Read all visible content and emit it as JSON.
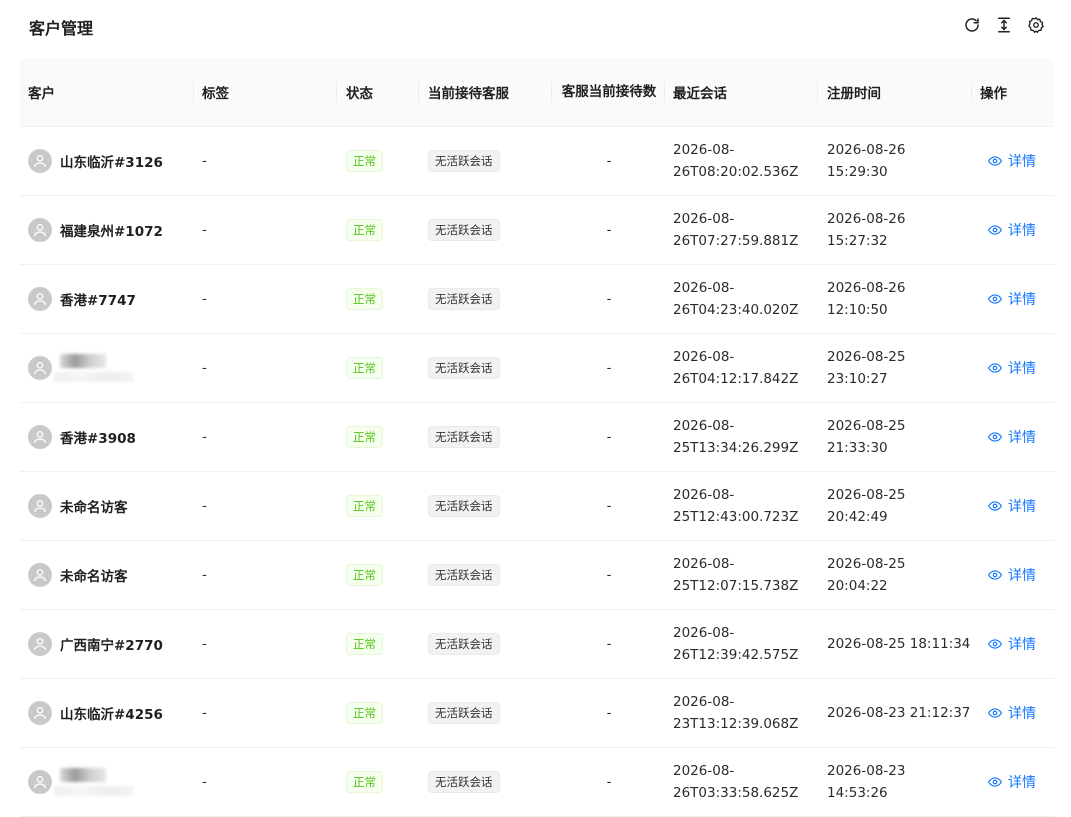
{
  "page": {
    "title": "客户管理"
  },
  "toolbar": {
    "icons": [
      "refresh-icon",
      "column-height-icon",
      "settings-icon"
    ]
  },
  "table": {
    "columns": {
      "customer": "客户",
      "tags": "标签",
      "status": "状态",
      "current_agent": "当前接待客服",
      "agent_count": "客服当前接待数",
      "last_session": "最近会话",
      "register_time": "注册时间",
      "actions": "操作"
    },
    "rows": [
      {
        "name": "山东临沂#3126",
        "tags": "-",
        "status": "正常",
        "agent": "无活跃会话",
        "agent_count": "-",
        "last_session": "2026-08-\n26T08:20:02.536Z",
        "register_time": "2026-08-26\n15:29:30",
        "action": "详情"
      },
      {
        "name": "福建泉州#1072",
        "tags": "-",
        "status": "正常",
        "agent": "无活跃会话",
        "agent_count": "-",
        "last_session": "2026-08-\n26T07:27:59.881Z",
        "register_time": "2026-08-26\n15:27:32",
        "action": "详情"
      },
      {
        "name": "香港#7747",
        "tags": "-",
        "status": "正常",
        "agent": "无活跃会话",
        "agent_count": "-",
        "last_session": "2026-08-\n26T04:23:40.020Z",
        "register_time": "2026-08-26\n12:10:50",
        "action": "详情"
      },
      {
        "name": "",
        "tags": "-",
        "status": "正常",
        "agent": "无活跃会话",
        "agent_count": "-",
        "last_session": "2026-08-\n26T04:12:17.842Z",
        "register_time": "2026-08-25\n23:10:27",
        "action": "详情"
      },
      {
        "name": "香港#3908",
        "tags": "-",
        "status": "正常",
        "agent": "无活跃会话",
        "agent_count": "-",
        "last_session": "2026-08-\n25T13:34:26.299Z",
        "register_time": "2026-08-25\n21:33:30",
        "action": "详情"
      },
      {
        "name": "未命名访客",
        "tags": "-",
        "status": "正常",
        "agent": "无活跃会话",
        "agent_count": "-",
        "last_session": "2026-08-\n25T12:43:00.723Z",
        "register_time": "2026-08-25\n20:42:49",
        "action": "详情"
      },
      {
        "name": "未命名访客",
        "tags": "-",
        "status": "正常",
        "agent": "无活跃会话",
        "agent_count": "-",
        "last_session": "2026-08-\n25T12:07:15.738Z",
        "register_time": "2026-08-25\n20:04:22",
        "action": "详情"
      },
      {
        "name": "广西南宁#2770",
        "tags": "-",
        "status": "正常",
        "agent": "无活跃会话",
        "agent_count": "-",
        "last_session": "2026-08-\n26T12:39:42.575Z",
        "register_time": "2026-08-25 18:11:34",
        "action": "详情"
      },
      {
        "name": "山东临沂#4256",
        "tags": "-",
        "status": "正常",
        "agent": "无活跃会话",
        "agent_count": "-",
        "last_session": "2026-08-\n23T13:12:39.068Z",
        "register_time": "2026-08-23 21:12:37",
        "action": "详情"
      },
      {
        "name": "",
        "tags": "-",
        "status": "正常",
        "agent": "无活跃会话",
        "agent_count": "-",
        "last_session": "2026-08-\n26T03:33:58.625Z",
        "register_time": "2026-08-23\n14:53:26",
        "action": "详情"
      }
    ]
  },
  "colors": {
    "accent": "#1677ff",
    "status_ok": "#52c41a",
    "header_bg": "#fafafa"
  }
}
